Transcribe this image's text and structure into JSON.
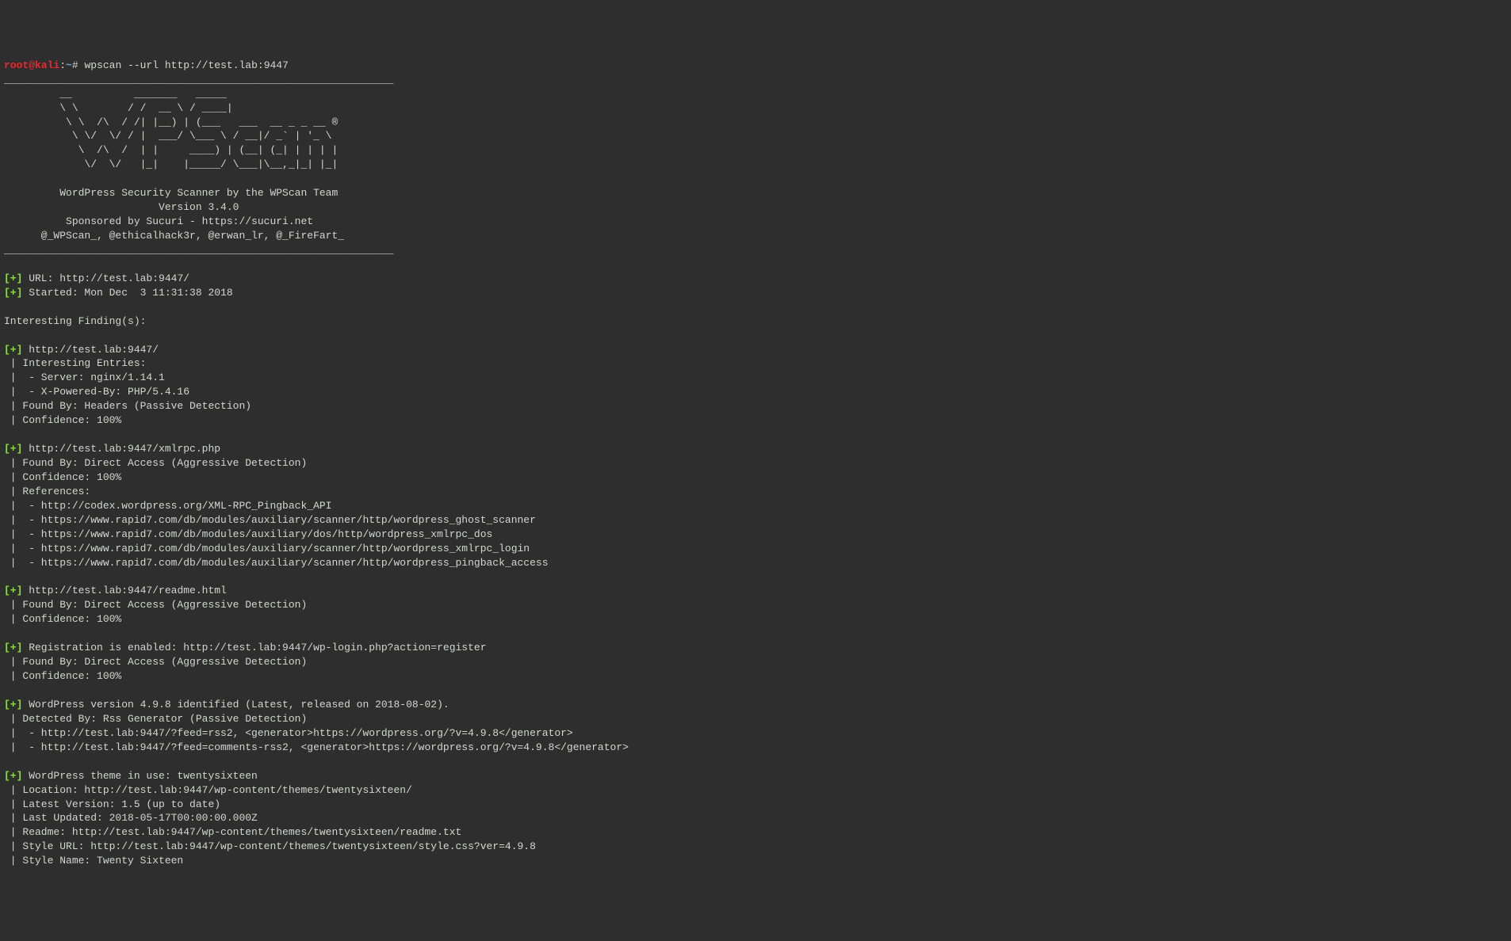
{
  "prompt_user": "root@kali",
  "prompt_sep": ":",
  "prompt_path": "~",
  "prompt_hash": "#",
  "cmd": " wpscan --url http://test.lab:9447",
  "underline": "_______________________________________________________________",
  "ascii1": "         __          _______   _____                  ",
  "ascii2": "         \\ \\        / /  __ \\ / ____|                 ",
  "ascii3": "          \\ \\  /\\  / /| |__) | (___   ___  __ _ _ __ ®",
  "ascii4": "           \\ \\/  \\/ / |  ___/ \\___ \\ / __|/ _` | '_ \\ ",
  "ascii5": "            \\  /\\  /  | |     ____) | (__| (_| | | | |",
  "ascii6": "             \\/  \\/   |_|    |_____/ \\___|\\__,_|_| |_|",
  "tag1": "         WordPress Security Scanner by the WPScan Team",
  "tag2": "                         Version 3.4.0",
  "tag3": "          Sponsored by Sucuri - https://sucuri.net",
  "tag4": "      @_WPScan_, @ethicalhack3r, @erwan_lr, @_FireFart_",
  "plus": "[+]",
  "url_line": " URL: http://test.lab:9447/",
  "started_line": " Started: Mon Dec  3 11:31:38 2018",
  "finding_header": "Interesting Finding(s):",
  "f1a": " http://test.lab:9447/",
  "f1b": " | Interesting Entries:",
  "f1c": " |  - Server: nginx/1.14.1",
  "f1d": " |  - X-Powered-By: PHP/5.4.16",
  "f1e": " | Found By: Headers (Passive Detection)",
  "f1f": " | Confidence: 100%",
  "f2a": " http://test.lab:9447/xmlrpc.php",
  "f2b": " | Found By: Direct Access (Aggressive Detection)",
  "f2c": " | Confidence: 100%",
  "f2d": " | References:",
  "f2e": " |  - http://codex.wordpress.org/XML-RPC_Pingback_API",
  "f2f": " |  - https://www.rapid7.com/db/modules/auxiliary/scanner/http/wordpress_ghost_scanner",
  "f2g": " |  - https://www.rapid7.com/db/modules/auxiliary/dos/http/wordpress_xmlrpc_dos",
  "f2h": " |  - https://www.rapid7.com/db/modules/auxiliary/scanner/http/wordpress_xmlrpc_login",
  "f2i": " |  - https://www.rapid7.com/db/modules/auxiliary/scanner/http/wordpress_pingback_access",
  "f3a": " http://test.lab:9447/readme.html",
  "f3b": " | Found By: Direct Access (Aggressive Detection)",
  "f3c": " | Confidence: 100%",
  "f4a": " Registration is enabled: http://test.lab:9447/wp-login.php?action=register",
  "f4b": " | Found By: Direct Access (Aggressive Detection)",
  "f4c": " | Confidence: 100%",
  "f5a": " WordPress version 4.9.8 identified (Latest, released on 2018-08-02).",
  "f5b": " | Detected By: Rss Generator (Passive Detection)",
  "f5c": " |  - http://test.lab:9447/?feed=rss2, <generator>https://wordpress.org/?v=4.9.8</generator>",
  "f5d": " |  - http://test.lab:9447/?feed=comments-rss2, <generator>https://wordpress.org/?v=4.9.8</generator>",
  "f6a": " WordPress theme in use: twentysixteen",
  "f6b": " | Location: http://test.lab:9447/wp-content/themes/twentysixteen/",
  "f6c": " | Latest Version: 1.5 (up to date)",
  "f6d": " | Last Updated: 2018-05-17T00:00:00.000Z",
  "f6e": " | Readme: http://test.lab:9447/wp-content/themes/twentysixteen/readme.txt",
  "f6f": " | Style URL: http://test.lab:9447/wp-content/themes/twentysixteen/style.css?ver=4.9.8",
  "f6g": " | Style Name: Twenty Sixteen"
}
